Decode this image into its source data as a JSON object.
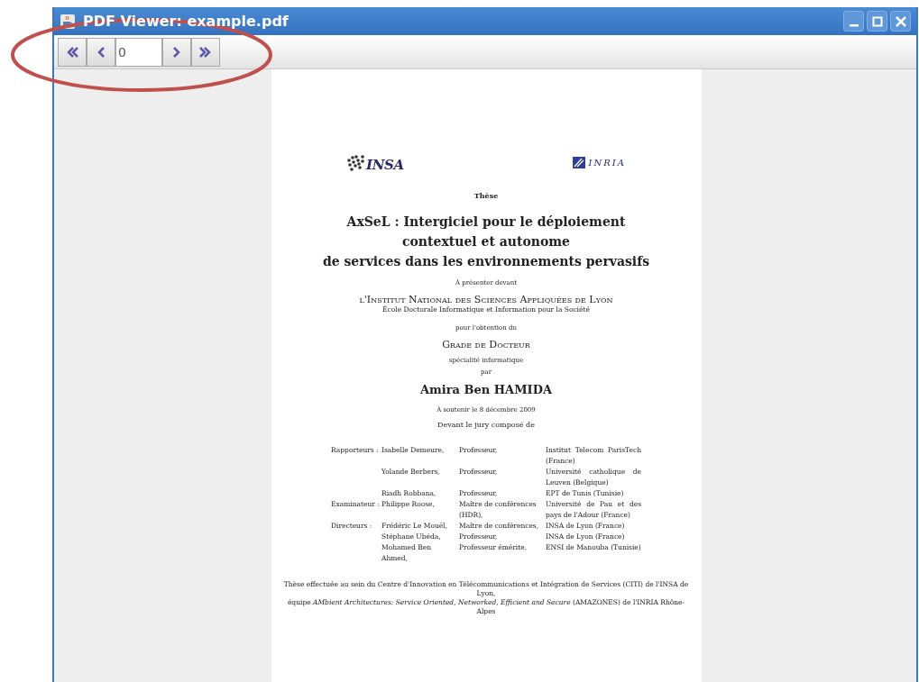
{
  "window": {
    "title": "PDF Viewer: example.pdf",
    "controls": [
      {
        "kind": "minimize"
      },
      {
        "kind": "maximize"
      },
      {
        "kind": "close"
      }
    ]
  },
  "toolbar": {
    "buttons_before": [
      {
        "kind": "first"
      },
      {
        "kind": "previous"
      }
    ],
    "page_field": {
      "value": "0"
    },
    "buttons_after": [
      {
        "kind": "next"
      },
      {
        "kind": "last"
      }
    ]
  },
  "annotation": {
    "kind": "ellipse"
  },
  "document": {
    "logos": [
      {
        "kind": "insa",
        "text": "INSA"
      },
      {
        "kind": "inria",
        "text": "INRIA"
      }
    ],
    "thesis_label": "Thèse",
    "title_lines": [
      "AxSeL : Intergiciel pour le déploiement",
      "contextuel et autonome",
      "de services dans les environnements pervasifs"
    ],
    "presented_before": "À présenter devant",
    "institute": "l'Institut National des Sciences Appliquées de Lyon",
    "school": "École Doctorale Informatique et Information pour la Société",
    "for_obtaining": "pour l'obtention du",
    "degree": "Grade de Docteur",
    "speciality": "spécialité informatique",
    "by": "par",
    "author": "Amira Ben HAMIDA",
    "defense_date": "À soutenir le 8 décembre 2009",
    "jury_intro": "Devant le jury composé de",
    "jury": [
      {
        "role": "Rapporteurs :",
        "name": "Isabelle Demeure,",
        "position": "Professeur,",
        "institution": "Institut Telecom ParisTech (France)"
      },
      {
        "name": "Yolande Berbers,",
        "position": "Professeur,",
        "institution": "Université catholique de Leuven (Belgique)"
      },
      {
        "name": "Riadh Robbana,",
        "position": "Professeur,",
        "institution": "EPT de Tunis (Tunisie)"
      },
      {
        "role": "Examinateur :",
        "name": "Philippe Roose,",
        "position": "Maître de conférences (HDR),",
        "institution": "Université de Pau et des pays de l'Adour (France)"
      },
      {
        "role": "Directeurs :",
        "name": "Frédéric Le Mouël,",
        "position": "Maître de conférences,",
        "institution": "INSA de Lyon (France)"
      },
      {
        "name": "Stéphane Ubéda,",
        "position": "Professeur,",
        "institution": "INSA de Lyon (France)"
      },
      {
        "name": "Mohamed Ben Ahmed,",
        "position": "Professeur émérite,",
        "institution": "ENSI de Manouba (Tunisie)"
      }
    ],
    "footer": [
      "Thèse effectuée au sein du Centre d'Innovation en Télécommunications et Intégration de Services (CITI) de l'INSA de Lyon,",
      "équipe *AMbient Architectures: Service Oriented, Networked, Efficient and Secure* (AMAZONES) de l'INRIA Rhône-Alpes"
    ]
  }
}
